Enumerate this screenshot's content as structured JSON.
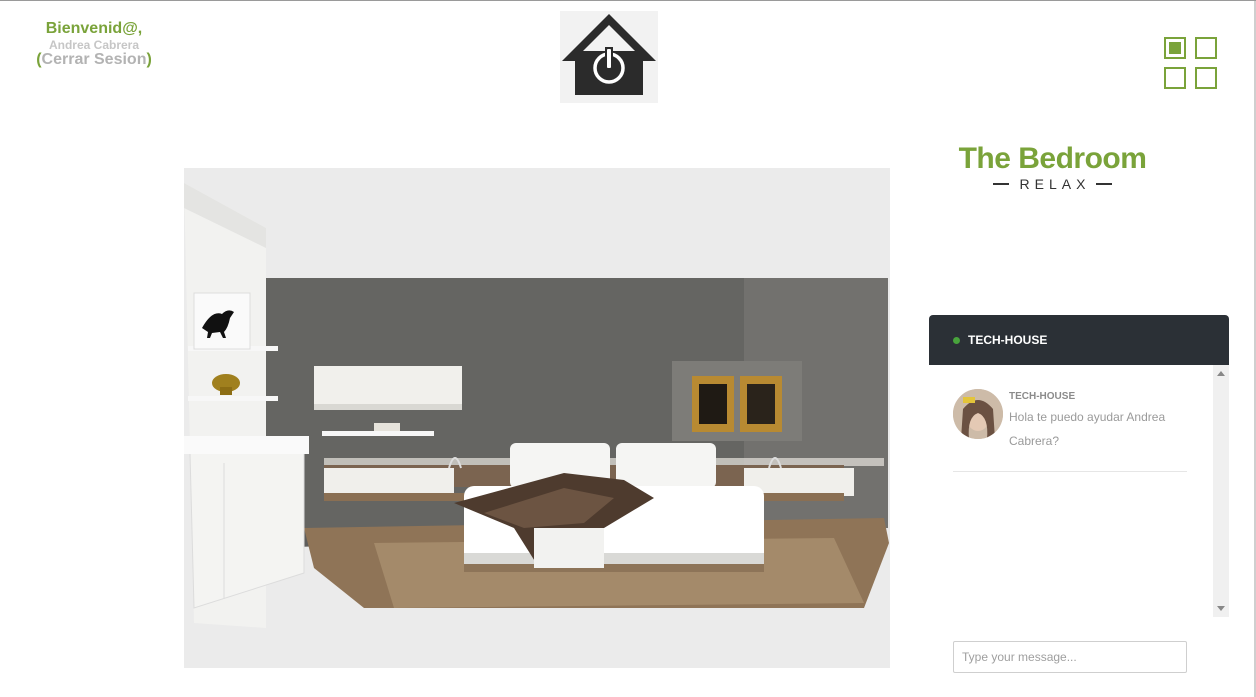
{
  "header": {
    "welcome": "Bienvenid@,",
    "user_name": "Andrea Cabrera",
    "logout_open": "(",
    "logout_label": "Cerrar Sesion",
    "logout_close": ")",
    "logo_icon": "house-power-icon",
    "menu_icon": "grid-menu-icon"
  },
  "room": {
    "title": "The Bedroom",
    "subtitle": "RELAX",
    "image": "bedroom-photo"
  },
  "chat": {
    "title": "TECH-HOUSE",
    "status_color": "#48a33c",
    "messages": [
      {
        "author": "TECH-HOUSE",
        "text": "Hola te puedo ayudar Andrea Cabrera?"
      }
    ],
    "input_placeholder": "Type your message..."
  },
  "colors": {
    "accent": "#7aa33a",
    "chat_header": "#2b3036"
  }
}
